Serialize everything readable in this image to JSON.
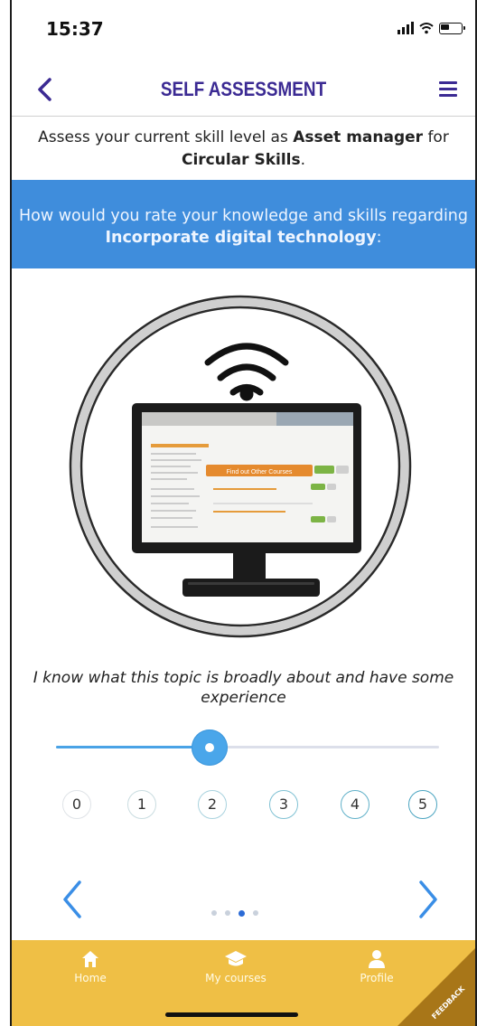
{
  "status": {
    "time": "15:37"
  },
  "nav": {
    "title": "SELF ASSESSMENT",
    "back_icon": "chevron-left-icon",
    "menu_icon": "hamburger-menu-icon"
  },
  "intro": {
    "prefix": "Assess your current skill level as ",
    "role": "Asset manager",
    "middle": " for ",
    "area": "Circular Skills",
    "suffix": "."
  },
  "question": {
    "prefix": "How would you rate your knowledge and skills regarding ",
    "topic": "Incorporate digital technology",
    "suffix": ":"
  },
  "illustration": {
    "screen_button_text": "Find out Other Courses",
    "icon": "computer-monitor-with-wifi-icon"
  },
  "level_description": "I know what this topic is broadly about and have some experience",
  "slider": {
    "value": 2,
    "min": 0,
    "max": 5
  },
  "levels": [
    "0",
    "1",
    "2",
    "3",
    "4",
    "5"
  ],
  "pagination": {
    "total": 4,
    "current_index": 2
  },
  "tabs": [
    {
      "label": "Home",
      "icon": "home-icon"
    },
    {
      "label": "My courses",
      "icon": "graduation-cap-icon"
    },
    {
      "label": "Profile",
      "icon": "person-icon"
    }
  ],
  "feedback_label": "FEEDBACK",
  "colors": {
    "primary": "#3b2a93",
    "question_bg": "#3f8ddc",
    "accent": "#4aa6ea",
    "tabbar": "#efbf45",
    "feedback": "#a87618"
  }
}
